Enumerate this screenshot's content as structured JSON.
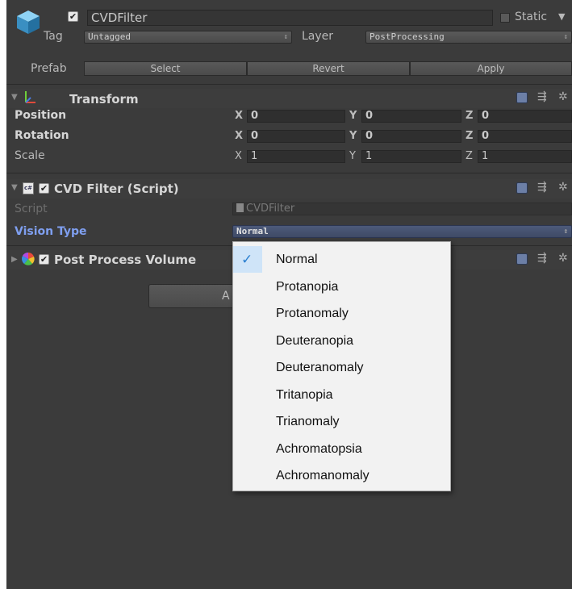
{
  "gameobject": {
    "active": true,
    "name": "CVDFilter",
    "static_label": "Static",
    "tag_label": "Tag",
    "tag_value": "Untagged",
    "layer_label": "Layer",
    "layer_value": "PostProcessing",
    "prefab_label": "Prefab",
    "select_label": "Select",
    "revert_label": "Revert",
    "apply_label": "Apply"
  },
  "transform": {
    "title": "Transform",
    "rows": [
      {
        "label": "Position",
        "x": "0",
        "y": "0",
        "z": "0"
      },
      {
        "label": "Rotation",
        "x": "0",
        "y": "0",
        "z": "0"
      },
      {
        "label": "Scale",
        "x": "1",
        "y": "1",
        "z": "1"
      }
    ],
    "axis_x": "X",
    "axis_y": "Y",
    "axis_z": "Z"
  },
  "cvd_filter": {
    "title": "CVD Filter (Script)",
    "script_label": "Script",
    "script_value": "CVDFilter",
    "vision_type_label": "Vision Type",
    "vision_type_value": "Normal"
  },
  "post_process": {
    "title": "Post Process Volume"
  },
  "add_component_partial": "A",
  "dropdown_menu": {
    "selected_index": 0,
    "options": [
      "Normal",
      "Protanopia",
      "Protanomaly",
      "Deuteranopia",
      "Deuteranomaly",
      "Tritanopia",
      "Trianomaly",
      "Achromatopsia",
      "Achromanomaly"
    ]
  },
  "colors": {
    "panel_bg": "#3b3b3b",
    "highlight_blue": "#7f9ff0",
    "menu_check": "#2a7fd0",
    "menu_bg": "#f2f2f2"
  },
  "icons": [
    "cube-icon",
    "transform-axes-icon",
    "script-icon",
    "post-process-icon",
    "help-icon",
    "preset-icon",
    "gear-icon"
  ]
}
